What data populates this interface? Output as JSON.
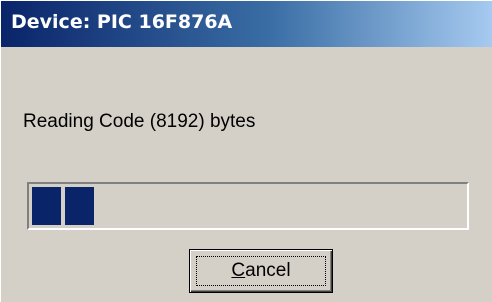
{
  "window": {
    "title": "Device: PIC 16F876A"
  },
  "status": {
    "message": "Reading Code (8192) bytes"
  },
  "progress": {
    "filled_blocks": 2,
    "fraction": 0.14,
    "bar_color": "#0a246a"
  },
  "buttons": {
    "cancel_label": "Cancel"
  },
  "colors": {
    "face": "#d4d0c8",
    "title_gradient_start": "#0a246a",
    "title_gradient_end": "#a6caf0"
  }
}
